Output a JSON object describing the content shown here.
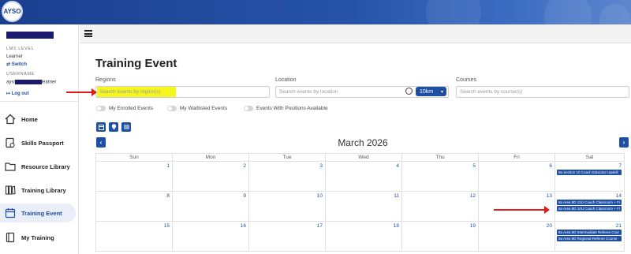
{
  "sidebar": {
    "lms_level_label": "LMS LEVEL",
    "lms_level_value": "Learner",
    "switch_label": "Switch",
    "username_label": "USERNAME",
    "username_prefix": "aysi",
    "username_suffix": "learner",
    "logout_label": "Log out",
    "items": [
      {
        "label": "Home",
        "icon": "home-icon"
      },
      {
        "label": "Skills Passport",
        "icon": "passport-icon"
      },
      {
        "label": "Resource Library",
        "icon": "folder-icon"
      },
      {
        "label": "Training Library",
        "icon": "library-icon"
      },
      {
        "label": "Training Event",
        "icon": "calendar-icon",
        "active": true
      },
      {
        "label": "My Training",
        "icon": "book-icon"
      }
    ]
  },
  "page": {
    "title": "Training Event"
  },
  "filters": {
    "regions": {
      "label": "Regions",
      "placeholder": "Search events by region(s)"
    },
    "location": {
      "label": "Location",
      "placeholder": "Search events by location",
      "radius": "10km"
    },
    "courses": {
      "label": "Courses",
      "placeholder": "Search events by course(s)"
    }
  },
  "toggles": [
    "My Enrolled Events",
    "My Waitlisted Events",
    "Events With Positions Available"
  ],
  "calendar": {
    "month": "March 2026",
    "weekdays": [
      "Sun",
      "Mon",
      "Tue",
      "Wed",
      "Thu",
      "Fri",
      "Sat"
    ],
    "weeks": [
      [
        "1",
        "2",
        "3",
        "4",
        "5",
        "6",
        "7"
      ],
      [
        "8",
        "9",
        "10",
        "11",
        "12",
        "13",
        "14"
      ],
      [
        "15",
        "16",
        "17",
        "18",
        "19",
        "20",
        "21"
      ]
    ],
    "events": {
      "w0": [
        "9a Section 10 Coach Educator Upskill"
      ],
      "w1": [
        "8a Area 8D 12U Coach Classroom + Fi",
        "8a Area 8D 10U Coach Classroom + Fi"
      ],
      "w2": [
        "8a Area 8D Intermediate Referee Cour",
        "8a Area 8D Regional Referee Course"
      ]
    }
  },
  "colors": {
    "accent": "#1e4fa3",
    "banner": "#1b3f8f",
    "highlight": "#f6f61e",
    "arrow": "#e01b1b"
  }
}
